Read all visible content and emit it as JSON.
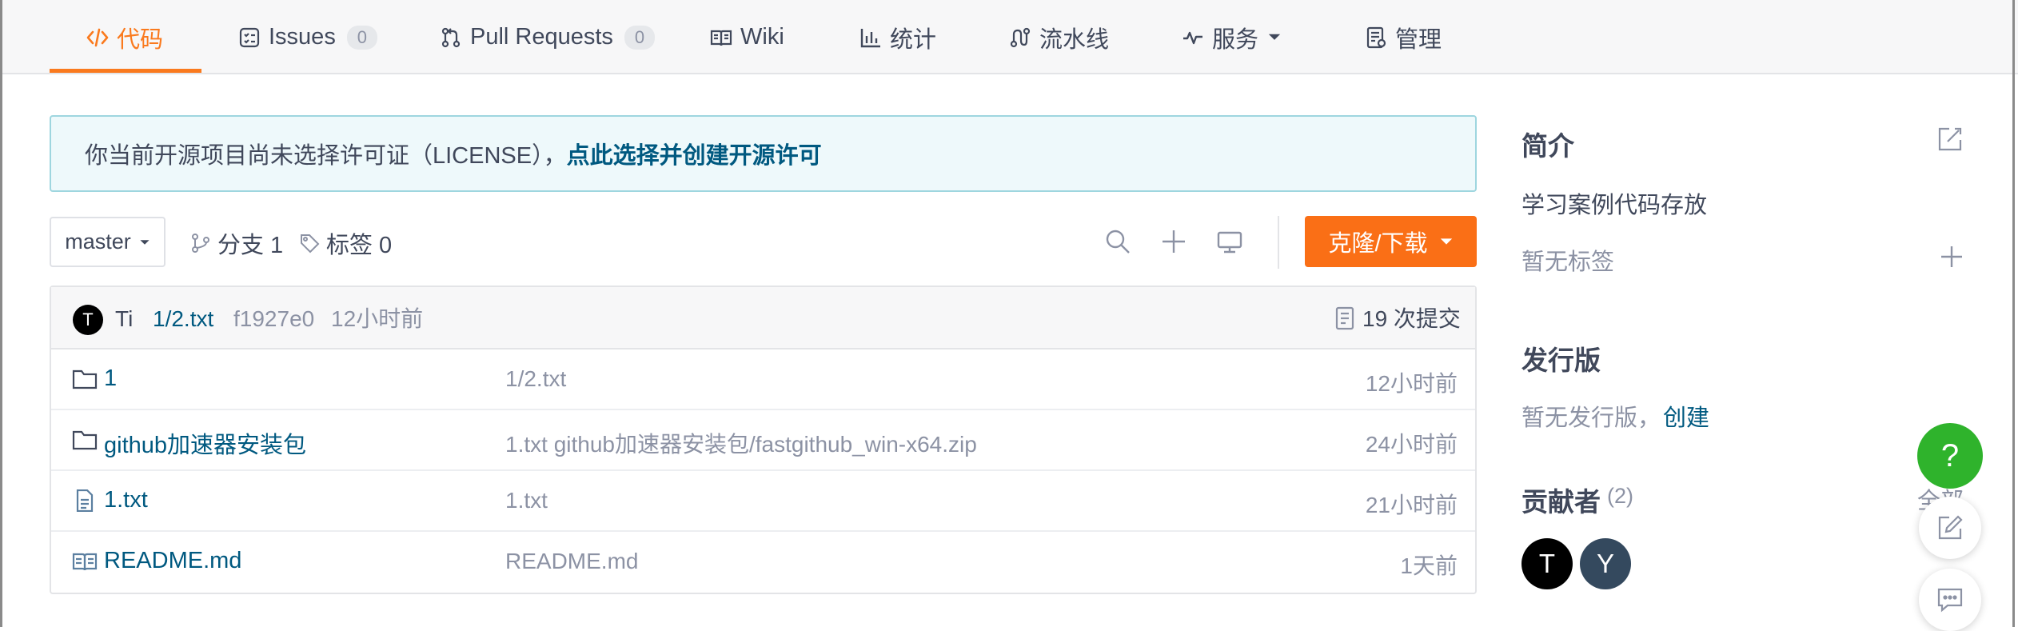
{
  "nav": {
    "tabs": [
      {
        "label": "代码",
        "icon": "code-icon",
        "active": true
      },
      {
        "label": "Issues",
        "icon": "issues-icon",
        "count": "0"
      },
      {
        "label": "Pull Requests",
        "icon": "pull-request-icon",
        "count": "0"
      },
      {
        "label": "Wiki",
        "icon": "wiki-book-icon"
      },
      {
        "label": "统计",
        "icon": "bar-chart-icon"
      },
      {
        "label": "流水线",
        "icon": "pipeline-icon"
      },
      {
        "label": "服务",
        "icon": "pulse-icon",
        "dropdown": true
      },
      {
        "label": "管理",
        "icon": "settings-doc-icon"
      }
    ]
  },
  "notice": {
    "text": "你当前开源项目尚未选择许可证（LICENSE），",
    "link": "点此选择并创建开源许可"
  },
  "toolbar": {
    "branch": "master",
    "branches_label": "分支 1",
    "tags_label": "标签 0",
    "clone_label": "克隆/下载"
  },
  "commit": {
    "avatar_letter": "T",
    "author": "Ti",
    "message": "1/2.txt",
    "hash": "f1927e0",
    "time": "12小时前",
    "commits_label": "19 次提交"
  },
  "files": [
    {
      "type": "folder",
      "name": "1",
      "message": "1/2.txt",
      "time": "12小时前"
    },
    {
      "type": "folder",
      "name": "github加速器安装包",
      "message": "1.txt github加速器安装包/fastgithub_win-x64.zip",
      "time": "24小时前"
    },
    {
      "type": "file",
      "name": "1.txt",
      "message": "1.txt",
      "time": "21小时前"
    },
    {
      "type": "readme",
      "name": "README.md",
      "message": "README.md",
      "time": "1天前"
    }
  ],
  "sidebar": {
    "intro_title": "简介",
    "description": "学习案例代码存放",
    "no_tags": "暂无标签",
    "release_title": "发行版",
    "no_release": "暂无发行版，",
    "create_link": "创建",
    "contributors_title": "贡献者",
    "contributors_count": "(2)",
    "all_link": "全部",
    "contributors": [
      {
        "letter": "T",
        "color": "#000000"
      },
      {
        "letter": "Y",
        "color": "#34495e"
      }
    ]
  },
  "float": {
    "help": "?"
  },
  "colors": {
    "accent": "#fa7a1e",
    "link": "#005980",
    "help_green": "#2fb32c"
  }
}
